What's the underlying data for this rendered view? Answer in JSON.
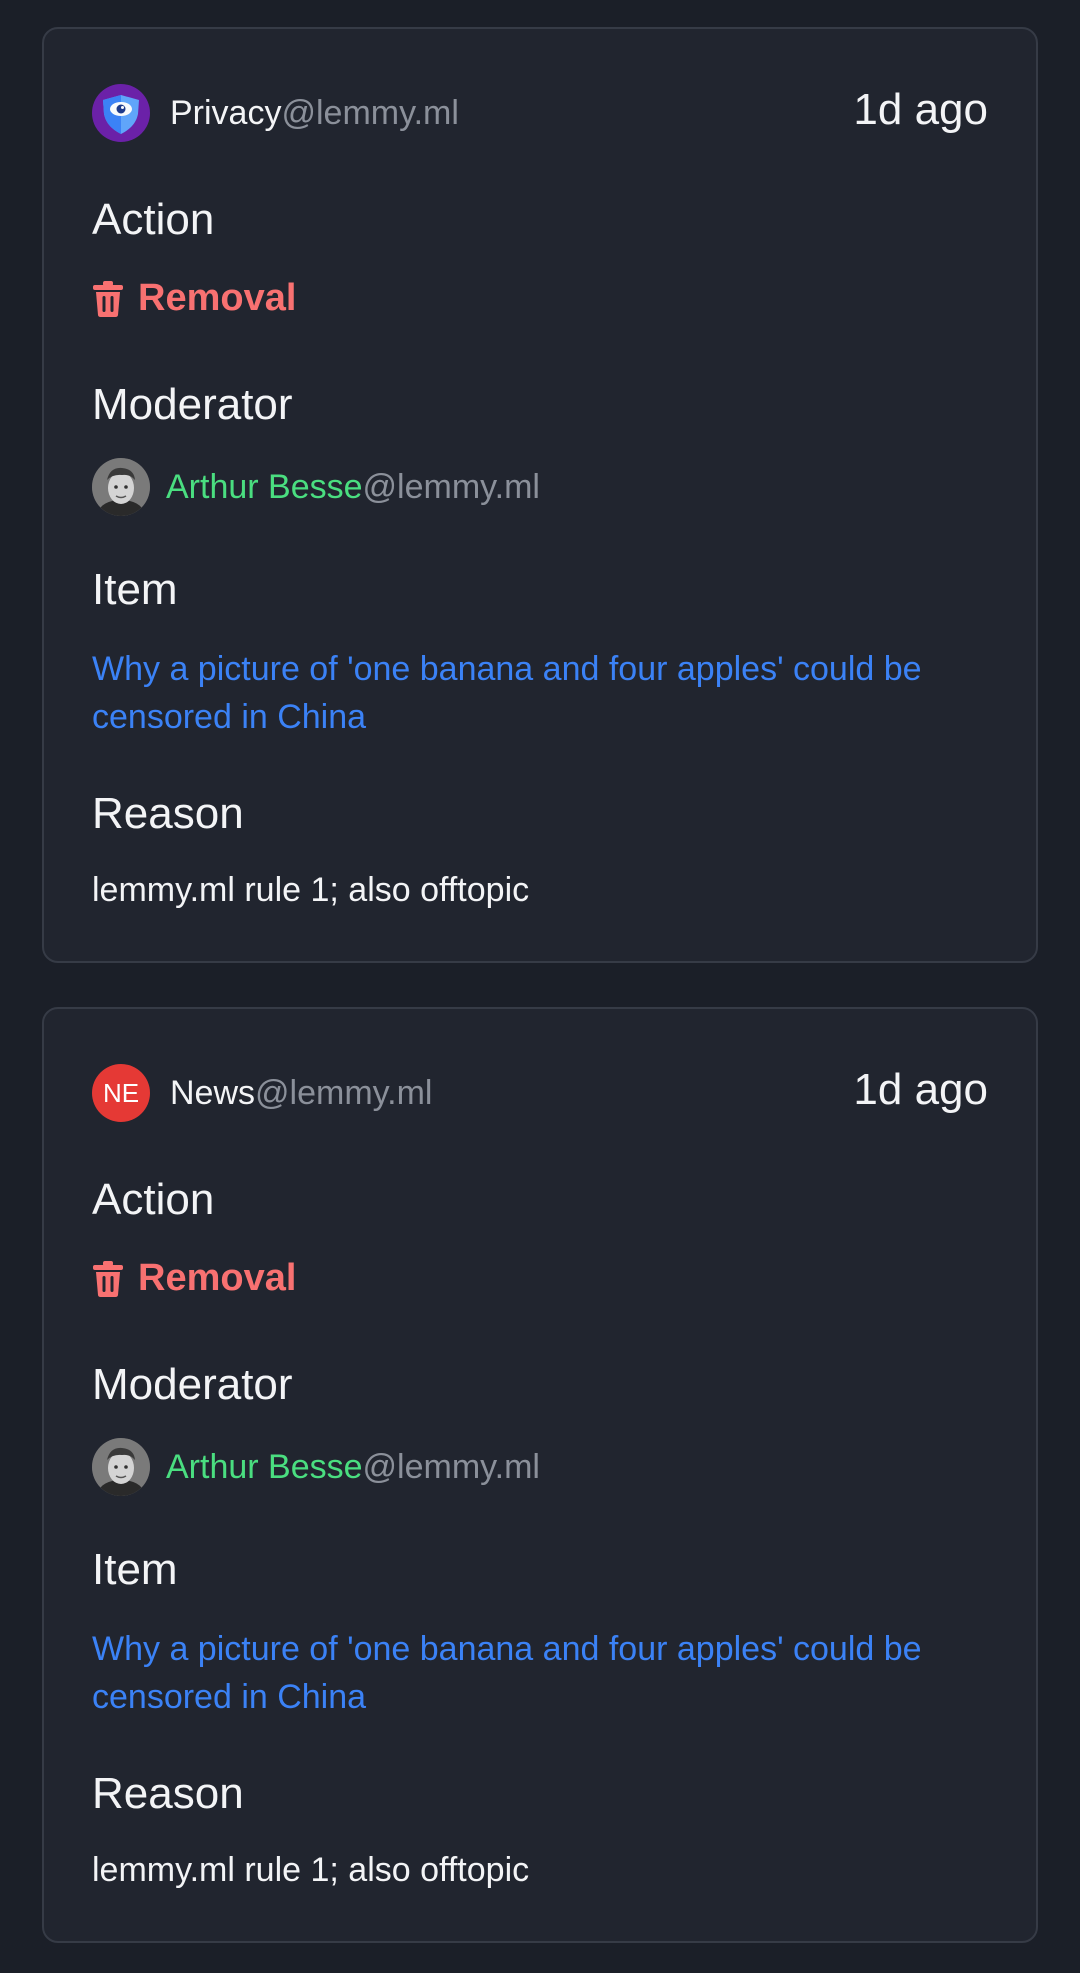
{
  "entries": [
    {
      "community": {
        "name": "Privacy",
        "domain": "@lemmy.ml",
        "icon": "eye-shield-icon"
      },
      "time": "1d ago",
      "action": {
        "heading": "Action",
        "label": "Removal",
        "icon": "trash-icon",
        "color": "#f87171"
      },
      "moderator": {
        "heading": "Moderator",
        "name": "Arthur Besse",
        "domain": "@lemmy.ml",
        "color": "#4ade80"
      },
      "item": {
        "heading": "Item",
        "text": "Why a picture of 'one banana and four apples' could be censored in China"
      },
      "reason": {
        "heading": "Reason",
        "text": "lemmy.ml rule 1; also offtopic"
      }
    },
    {
      "community": {
        "name": "News",
        "domain": "@lemmy.ml",
        "initials": "NE"
      },
      "time": "1d ago",
      "action": {
        "heading": "Action",
        "label": "Removal",
        "icon": "trash-icon",
        "color": "#f87171"
      },
      "moderator": {
        "heading": "Moderator",
        "name": "Arthur Besse",
        "domain": "@lemmy.ml",
        "color": "#4ade80"
      },
      "item": {
        "heading": "Item",
        "text": "Why a picture of 'one banana and four apples' could be censored in China"
      },
      "reason": {
        "heading": "Reason",
        "text": "lemmy.ml rule 1; also offtopic"
      }
    }
  ],
  "colors": {
    "background": "#1b1f28",
    "card": "#21252f",
    "link": "#3b82f6",
    "muted": "#8b909a"
  }
}
